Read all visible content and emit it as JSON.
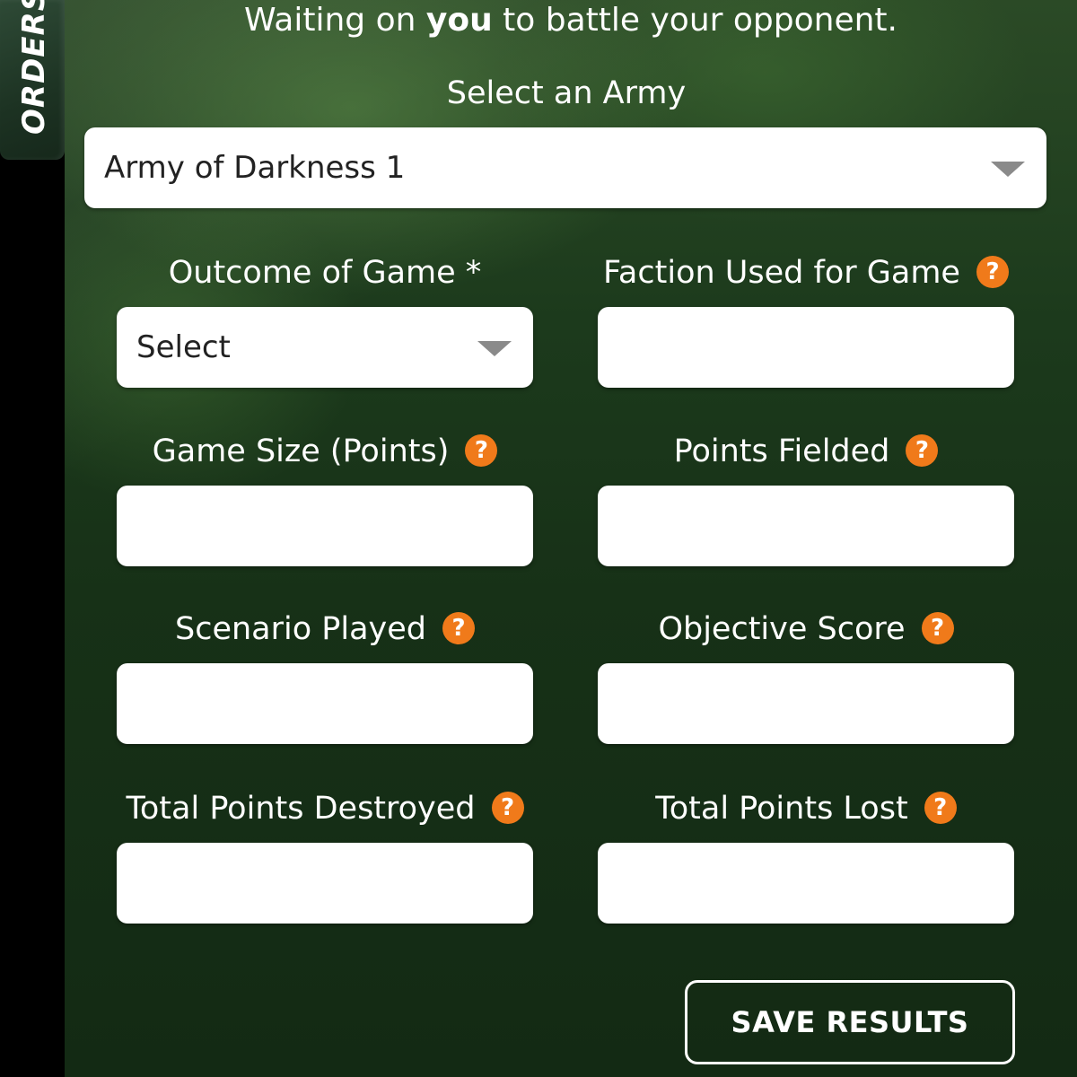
{
  "sidebar": {
    "orders_tab_label": "ORDERS"
  },
  "status": {
    "prefix": "Waiting on ",
    "emphasis": "you",
    "suffix": " to battle your opponent."
  },
  "army_select": {
    "label": "Select an Army",
    "selected_value": "Army of Darkness 1"
  },
  "fields": {
    "outcome": {
      "label": "Outcome of Game *",
      "selected_value": "Select"
    },
    "faction": {
      "label": "Faction Used for Game",
      "help_glyph": "?",
      "value": ""
    },
    "game_size": {
      "label": "Game Size (Points)",
      "help_glyph": "?",
      "value": ""
    },
    "points_fielded": {
      "label": "Points Fielded",
      "help_glyph": "?",
      "value": ""
    },
    "scenario": {
      "label": "Scenario Played",
      "help_glyph": "?",
      "value": ""
    },
    "objective_score": {
      "label": "Objective Score",
      "help_glyph": "?",
      "value": ""
    },
    "points_destroyed": {
      "label": "Total Points Destroyed",
      "help_glyph": "?",
      "value": ""
    },
    "points_lost": {
      "label": "Total Points Lost",
      "help_glyph": "?",
      "value": ""
    }
  },
  "actions": {
    "save_label": "SAVE RESULTS"
  },
  "colors": {
    "help_icon": "#f07a1a",
    "background_green": "#173117",
    "sidebar": "#000000"
  }
}
